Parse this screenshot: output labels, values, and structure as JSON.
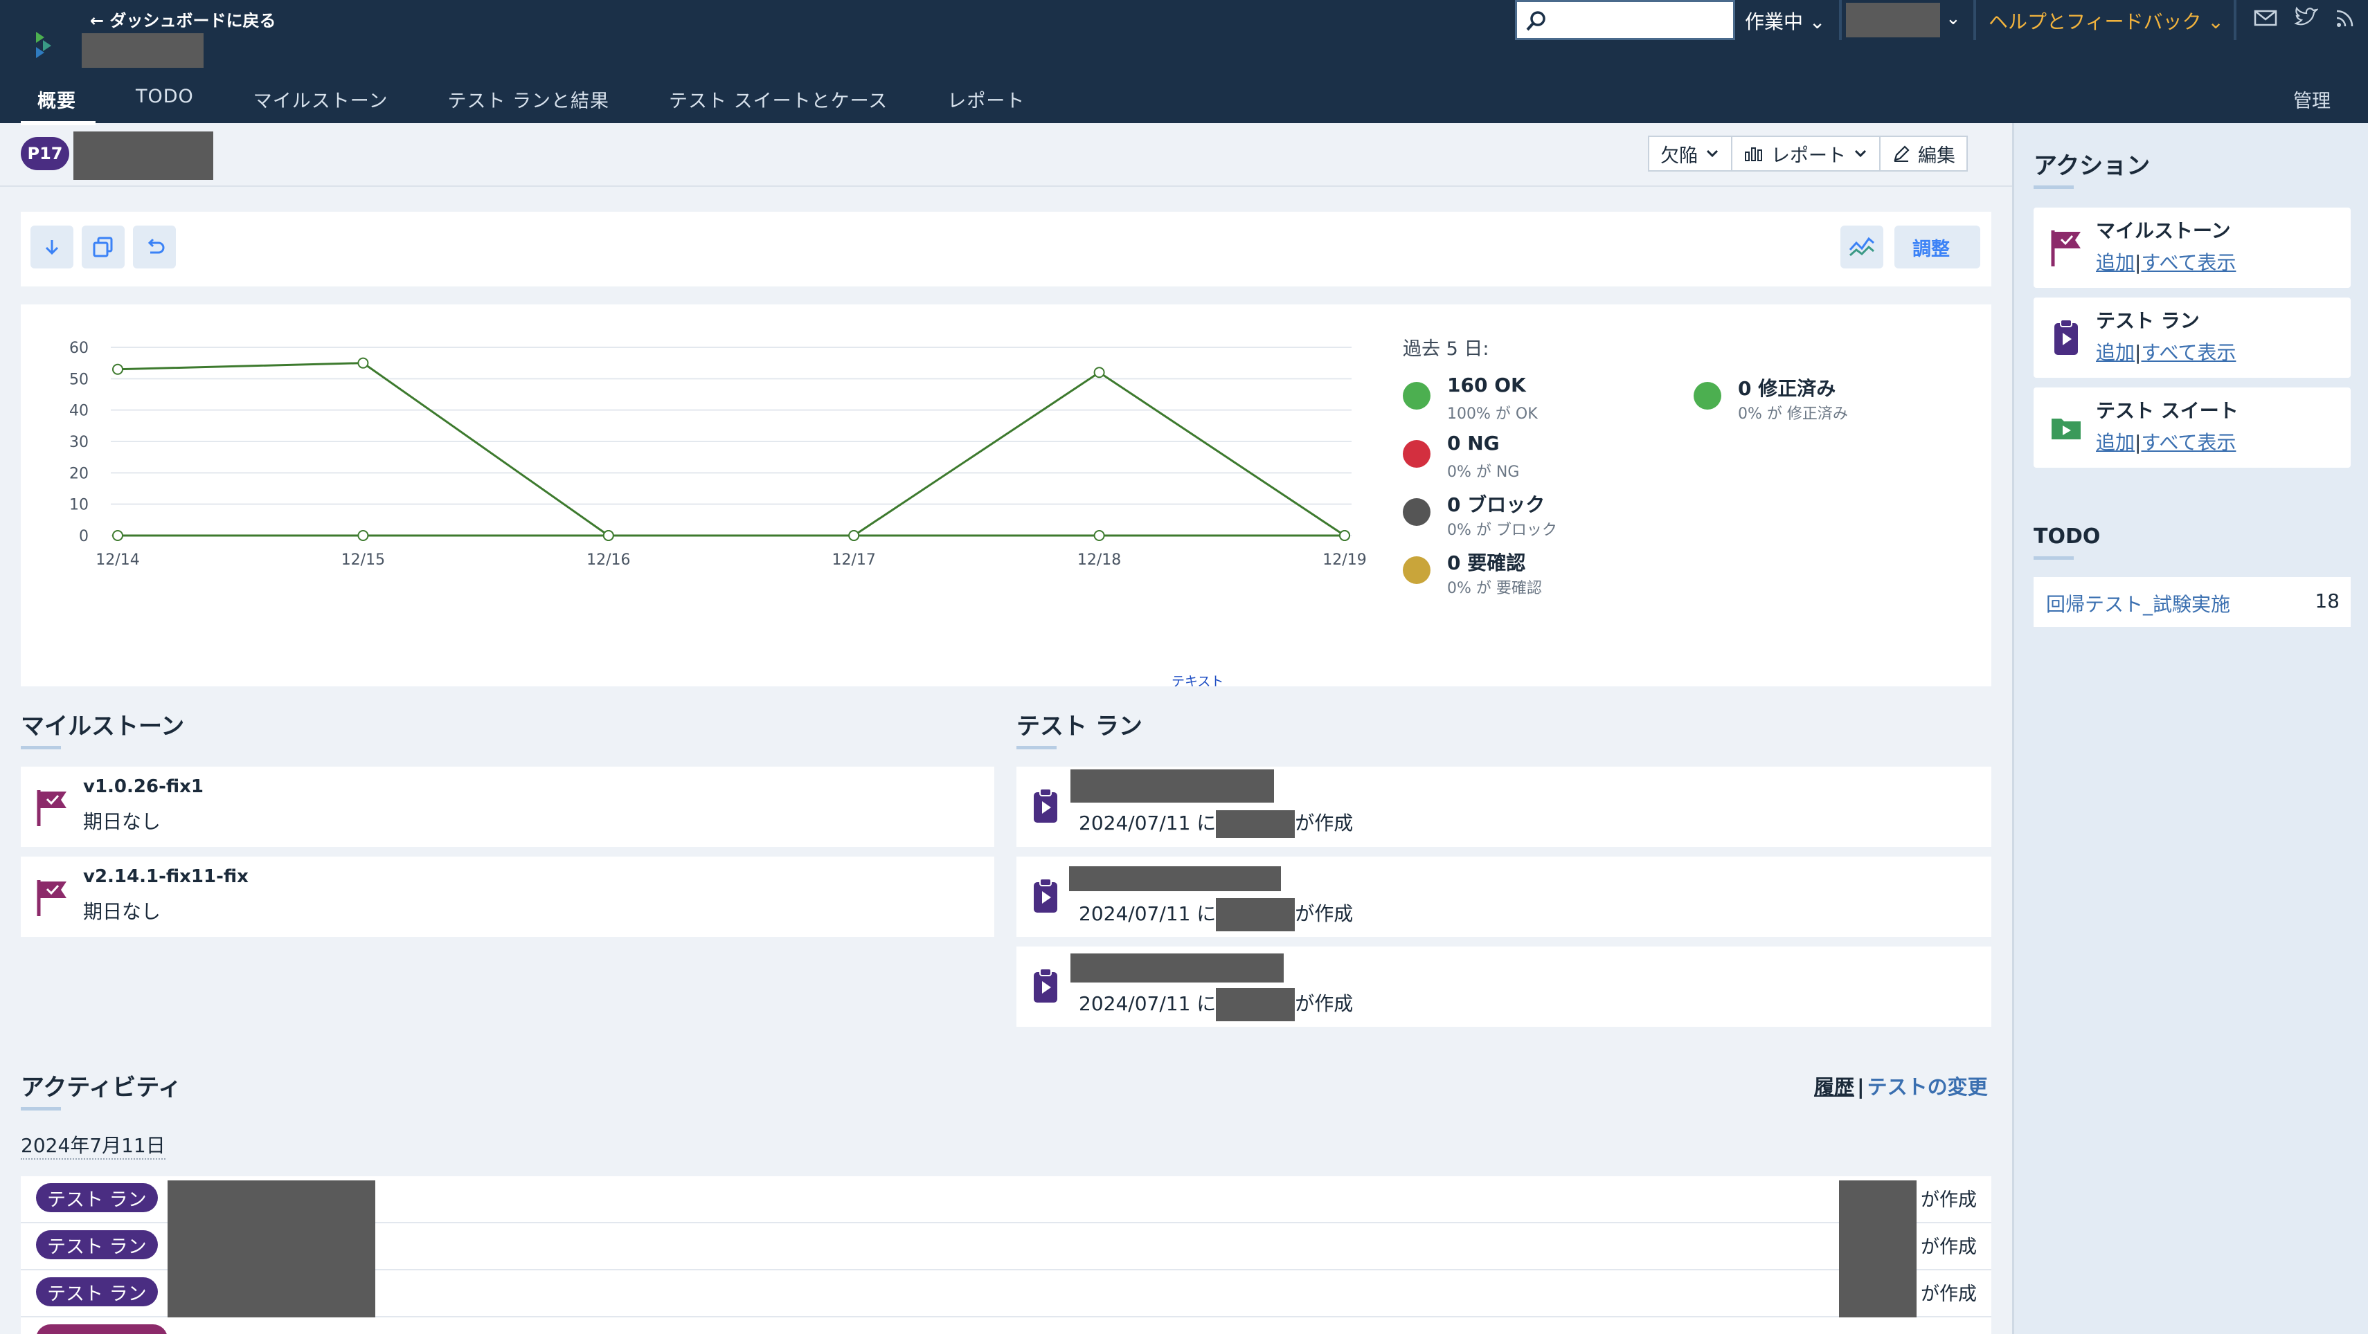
{
  "header": {
    "back_label": "← ダッシュボードに戻る",
    "search_placeholder": "",
    "status_label": "作業中",
    "help_label": "ヘルプとフィードバック",
    "icons": [
      "mail-icon",
      "twitter-icon",
      "rss-icon"
    ],
    "tabs": [
      {
        "label": "概要",
        "active": true
      },
      {
        "label": "TODO"
      },
      {
        "label": "マイルストーン"
      },
      {
        "label": "テスト ランと結果"
      },
      {
        "label": "テスト スイートとケース"
      },
      {
        "label": "レポート"
      }
    ],
    "admin_label": "管理"
  },
  "project": {
    "badge": "P17",
    "buttons": {
      "defects": "欠陥",
      "reports": "レポート",
      "edit": "編集"
    }
  },
  "toolbar": {
    "adjust_label": "調整"
  },
  "chart_data": {
    "type": "line",
    "x": [
      "12/14",
      "12/15",
      "12/16",
      "12/17",
      "12/18",
      "12/19"
    ],
    "series": [
      {
        "values": [
          53,
          55,
          0,
          0,
          52,
          0
        ]
      },
      {
        "values": [
          0,
          0,
          0,
          0,
          0,
          0
        ]
      }
    ],
    "ylim": [
      0,
      60
    ],
    "yticks": [
      "0",
      "10",
      "20",
      "30",
      "40",
      "50",
      "60"
    ],
    "grid": true,
    "line_color": "#3d7a2e",
    "footnote": "テキスト"
  },
  "legend": {
    "heading": "過去 5 日:",
    "items": [
      {
        "title": "160 OK",
        "sub": "100% が OK",
        "color": "#4caf50"
      },
      {
        "title": "0 修正済み",
        "sub": "0% が 修正済み",
        "color": "#4caf50"
      },
      {
        "title": "0 NG",
        "sub": "0% が NG",
        "color": "#d32f3f"
      },
      {
        "title": "0 ブロック",
        "sub": "0% が ブロック",
        "color": "#555555"
      },
      {
        "title": "0 要確認",
        "sub": "0% が 要確認",
        "color": "#c9a53a"
      }
    ]
  },
  "milestones": {
    "title": "マイルストーン",
    "items": [
      {
        "name": "v1.0.26-fix1",
        "due": "期日なし"
      },
      {
        "name": "v2.14.1-fix11-fix",
        "due": "期日なし"
      }
    ]
  },
  "test_runs": {
    "title": "テスト ラン",
    "items": [
      {
        "date_prefix": "2024/07/11 に",
        "suffix": "が作成"
      },
      {
        "date_prefix": "2024/07/11 に",
        "suffix": "が作成"
      },
      {
        "date_prefix": "2024/07/11 に",
        "suffix": "が作成"
      }
    ]
  },
  "activity": {
    "title": "アクティビティ",
    "history_label": "履歴",
    "separator": "|",
    "changes_label": "テストの変更",
    "date": "2024年7月11日",
    "rows": [
      {
        "badge": "テスト ラン",
        "by": "が作成"
      },
      {
        "badge": "テスト ラン",
        "by": "が作成"
      },
      {
        "badge": "テスト ラン",
        "by": "が作成"
      }
    ]
  },
  "sidebar": {
    "actions_title": "アクション",
    "actions": [
      {
        "name": "マイルストーン",
        "add": "追加",
        "sep": "|",
        "view_all": "すべて表示"
      },
      {
        "name": "テスト ラン",
        "add": "追加",
        "sep": "|",
        "view_all": "すべて表示"
      },
      {
        "name": "テスト スイート",
        "add": "追加",
        "sep": "|",
        "view_all": "すべて表示"
      }
    ],
    "todo_title": "TODO",
    "todo_items": [
      {
        "label": "回帰テスト_試験実施",
        "count": "18"
      }
    ]
  }
}
